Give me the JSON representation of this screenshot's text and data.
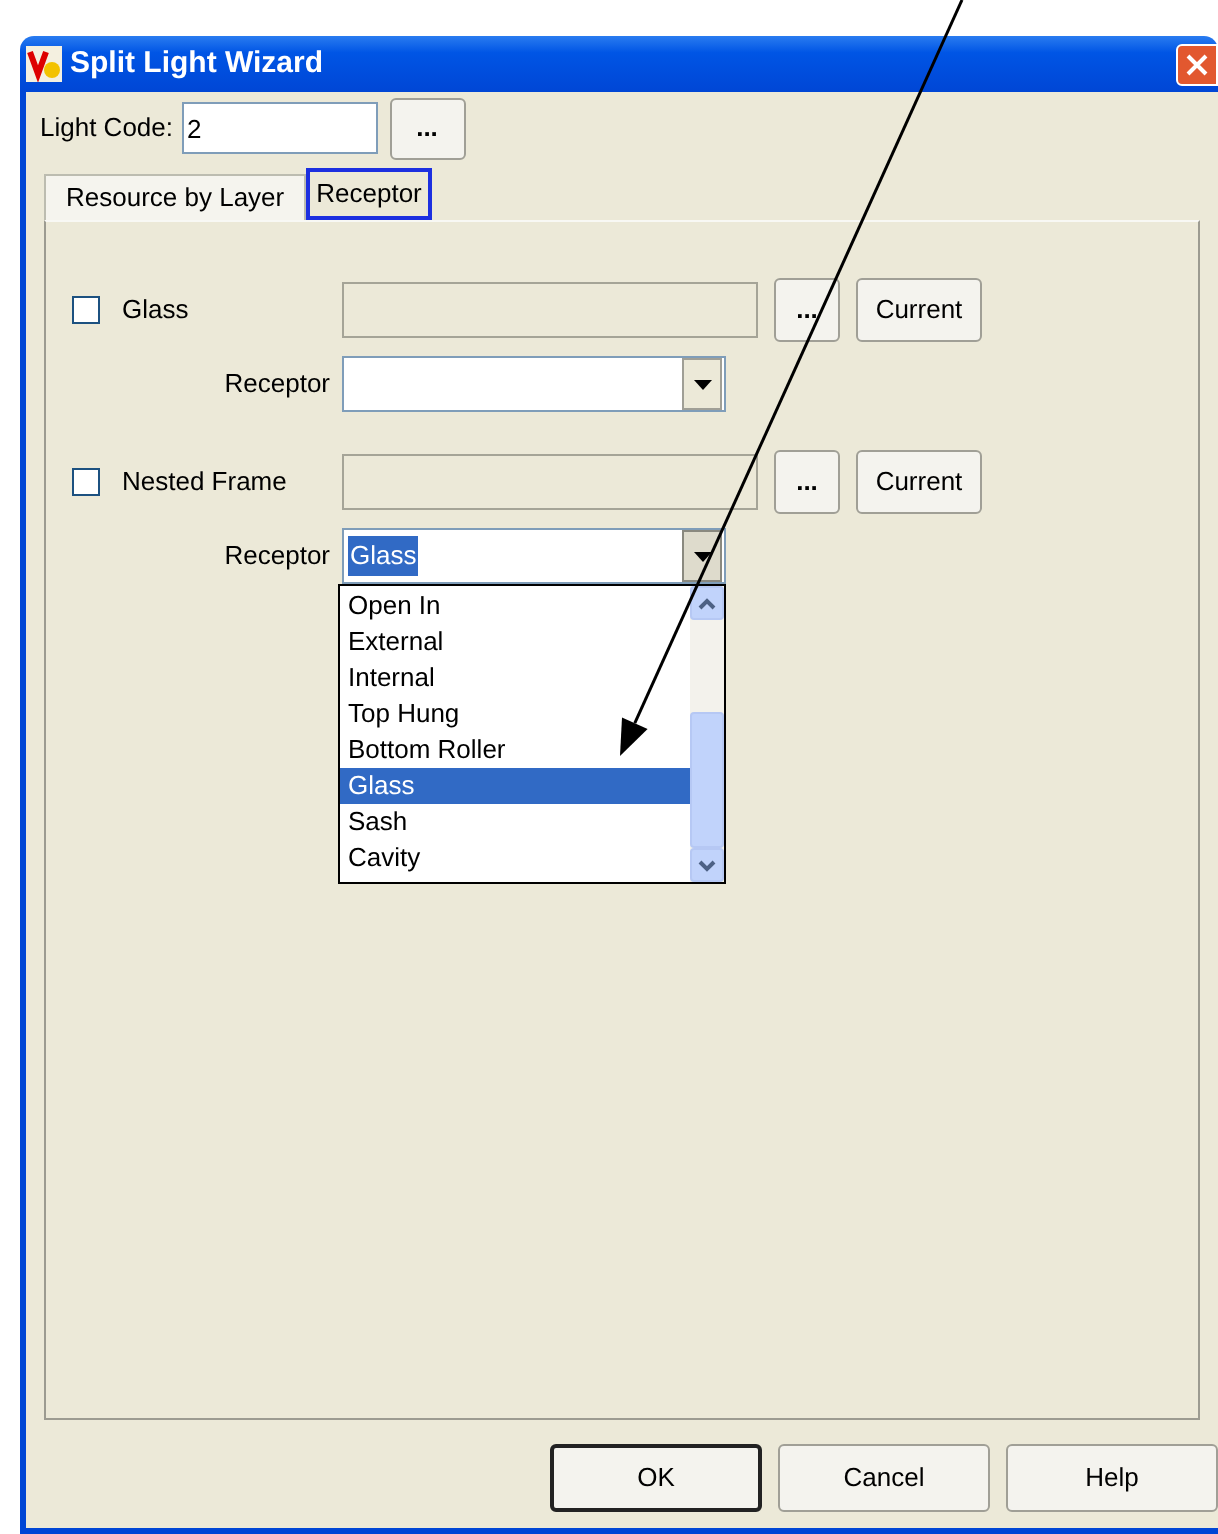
{
  "window": {
    "title": "Split Light Wizard"
  },
  "light_code": {
    "label": "Light Code:",
    "value": "2",
    "browse": "..."
  },
  "tabs": [
    {
      "label": "Resource by Layer",
      "selected": false
    },
    {
      "label": "Receptor",
      "selected": true
    }
  ],
  "rows": [
    {
      "label": "Glass",
      "checked": false,
      "browse": "...",
      "current": "Current",
      "receptor_label": "Receptor",
      "receptor_open": false
    },
    {
      "label": "Nested Frame",
      "checked": false,
      "browse": "...",
      "current": "Current",
      "receptor_label": "Receptor",
      "receptor_value": "Glass",
      "receptor_focused": true,
      "receptor_open": true,
      "options": [
        {
          "label": "Open In",
          "selected": false
        },
        {
          "label": "External",
          "selected": false
        },
        {
          "label": "Internal",
          "selected": false
        },
        {
          "label": "Top Hung",
          "selected": false
        },
        {
          "label": "Bottom Roller",
          "selected": false
        },
        {
          "label": "Glass",
          "selected": true
        },
        {
          "label": "Sash",
          "selected": false
        },
        {
          "label": "Cavity",
          "selected": false
        }
      ]
    }
  ],
  "buttons": [
    {
      "label": "OK",
      "default": true
    },
    {
      "label": "Cancel",
      "default": false
    },
    {
      "label": "Help",
      "default": false
    }
  ]
}
